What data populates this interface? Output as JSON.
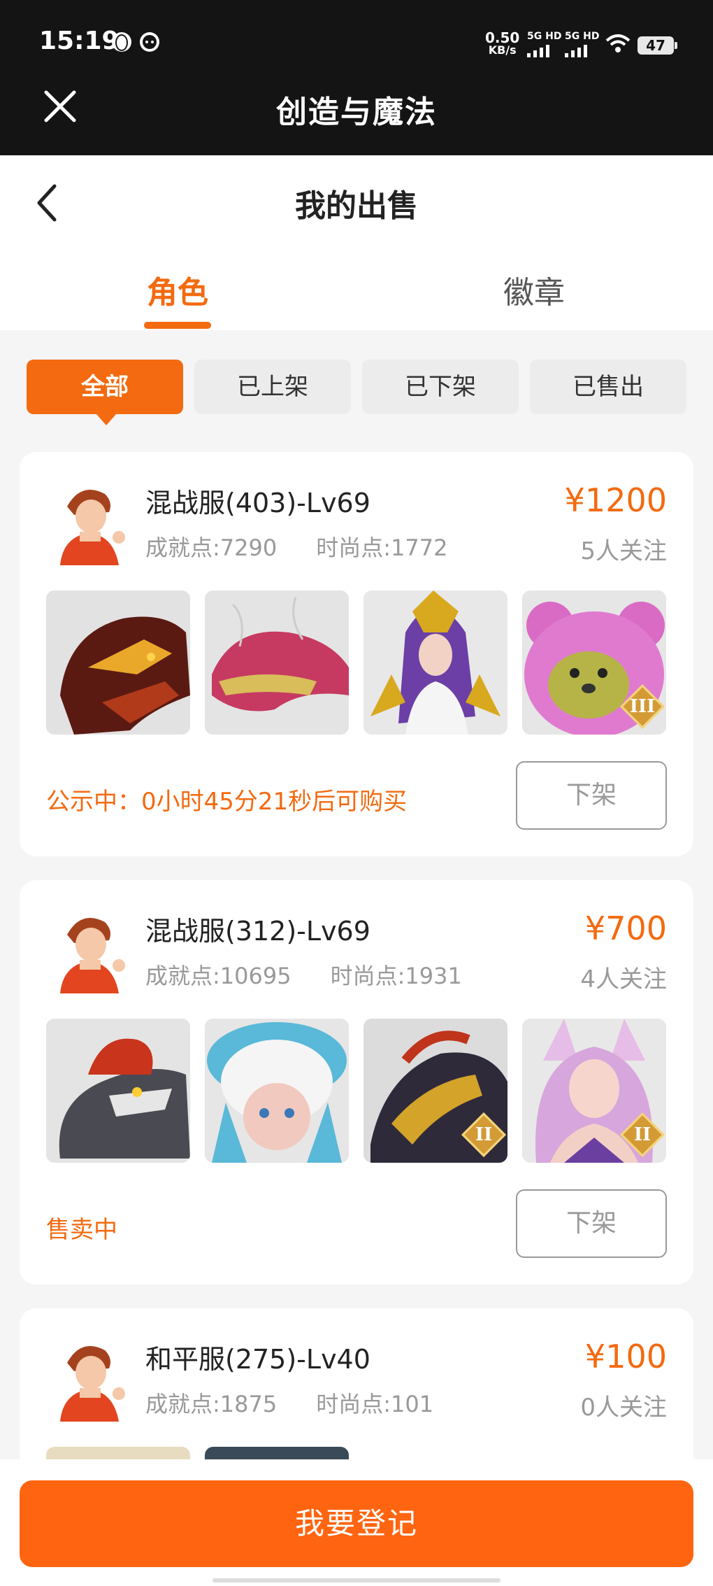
{
  "status_bar": {
    "time": "15:19",
    "net_speed_value": "0.50",
    "net_speed_unit": "KB/s",
    "sim1": "5G HD",
    "sim2": "5G HD",
    "battery": "47"
  },
  "app_bar": {
    "title": "创造与魔法"
  },
  "header": {
    "title": "我的出售"
  },
  "tabs": [
    {
      "label": "角色"
    },
    {
      "label": "徽章"
    }
  ],
  "filters": [
    {
      "label": "全部"
    },
    {
      "label": "已上架"
    },
    {
      "label": "已下架"
    },
    {
      "label": "已售出"
    }
  ],
  "listings": [
    {
      "server": "混战服(403)-Lv69",
      "achievement": "成就点:7290",
      "fashion": "时尚点:1772",
      "price": "¥1200",
      "followers": "5人关注",
      "status": "公示中：0小时45分21秒后可购买",
      "action": "下架",
      "items": [
        {
          "icon": "fire-dragon-mount-icon"
        },
        {
          "icon": "pink-dragon-mount-icon"
        },
        {
          "icon": "purple-hair-warrior-icon"
        },
        {
          "icon": "pink-bear-pet-icon",
          "badge": "III"
        }
      ]
    },
    {
      "server": "混战服(312)-Lv69",
      "achievement": "成就点:10695",
      "fashion": "时尚点:1931",
      "price": "¥700",
      "followers": "4人关注",
      "status": "售卖中",
      "action": "下架",
      "items": [
        {
          "icon": "gray-dragon-mount-icon"
        },
        {
          "icon": "cloud-hair-doll-icon"
        },
        {
          "icon": "gold-dragon-mount-icon",
          "badge": "II"
        },
        {
          "icon": "fox-girl-icon",
          "badge": "II"
        }
      ]
    },
    {
      "server": "和平服(275)-Lv40",
      "achievement": "成就点:1875",
      "fashion": "时尚点:101",
      "price": "¥100",
      "followers": "0人关注"
    }
  ],
  "bottom": {
    "register_label": "我要登记"
  },
  "colors": {
    "accent": "#f36a10",
    "button": "#ff6510"
  }
}
